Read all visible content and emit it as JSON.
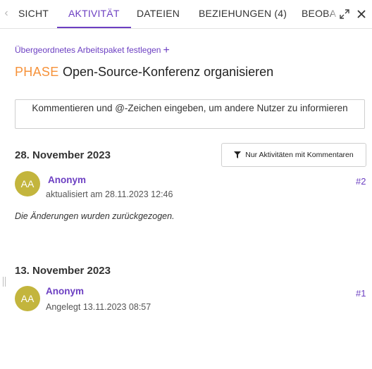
{
  "tabs": [
    {
      "label": "ÜBERSICHT",
      "visible_text": "SICHT",
      "active": false
    },
    {
      "label": "AKTIVITÄT",
      "active": true
    },
    {
      "label": "DATEIEN",
      "active": false
    },
    {
      "label": "BEZIEHUNGEN (4)",
      "active": false
    },
    {
      "label": "BEOBA",
      "active": false
    }
  ],
  "header_icons": {
    "scroll_left": "chevron-left-icon",
    "fullscreen": "expand-icon",
    "close": "close-icon"
  },
  "parent": {
    "link_label": "Übergeordnetes Arbeitspaket festlegen",
    "plus": "+"
  },
  "work_package": {
    "type": "PHASE",
    "subject": "Open-Source-Konferenz organisieren"
  },
  "comment": {
    "placeholder": "Kommentieren und @-Zeichen eingeben, um andere Nutzer zu informieren"
  },
  "filter": {
    "label": "Nur Aktivitäten mit Kommentaren",
    "icon": "filter-icon"
  },
  "days": [
    {
      "date": "28. November 2023",
      "entries": [
        {
          "avatar": "AA",
          "author": "Anonym",
          "meta": "aktualisiert am 28.11.2023 12:46",
          "number": "#2",
          "details": "Die Änderungen wurden zurückgezogen."
        }
      ]
    },
    {
      "date": "13. November 2023",
      "entries": [
        {
          "avatar": "AA",
          "author": "Anonym",
          "meta": "Angelegt 13.11.2023 08:57",
          "number": "#1"
        }
      ]
    }
  ],
  "colors": {
    "accent": "#6c3fc2",
    "type": "#f6923a",
    "avatar": "#c3b53d"
  }
}
